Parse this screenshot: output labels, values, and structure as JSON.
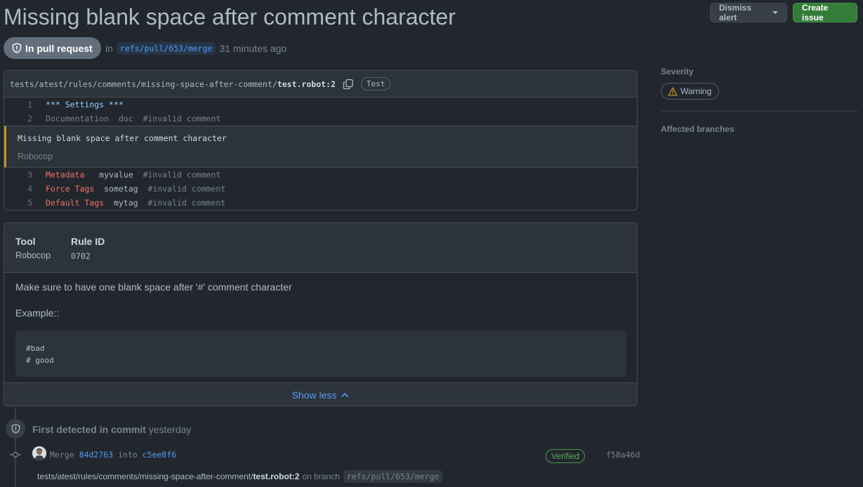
{
  "alert": {
    "title": "Missing blank space after comment character",
    "state": "In pull request",
    "in_word": "in",
    "ref": "refs/pull/653/merge",
    "time": "31 minutes ago"
  },
  "actions": {
    "dismiss_label": "Dismiss alert",
    "create_label": "Create issue"
  },
  "sidebar": {
    "severity_label": "Severity",
    "severity_value": "Warning",
    "branches_label": "Affected branches"
  },
  "code": {
    "path_prefix": "tests/atest/rules/comments/missing-space-after-comment/",
    "path_file": "test.robot:2",
    "tag": "Test",
    "lines_top": [
      {
        "n": "1",
        "a": "*** Settings ***",
        "b": "",
        "c": ""
      },
      {
        "n": "2",
        "a": "Documentation",
        "b": "  doc",
        "c": "  #invalid comment"
      }
    ],
    "alert_message": "Missing blank space after comment character",
    "alert_tool": "Robocop",
    "lines_bottom": [
      {
        "n": "3",
        "a": "Metadata",
        "b": "   myvalue",
        "c": "  #invalid comment"
      },
      {
        "n": "4",
        "a": "Force Tags",
        "b": "  sometag",
        "c": "  #invalid comment"
      },
      {
        "n": "5",
        "a": "Default Tags",
        "b": "  mytag",
        "c": "  #invalid comment"
      }
    ]
  },
  "rule": {
    "tool_label": "Tool",
    "tool_value": "Robocop",
    "id_label": "Rule ID",
    "id_value": "0702",
    "description": "Make sure to have one blank space after '#' comment character",
    "example_label": "Example::",
    "example_line1": "#bad",
    "example_line2": "# good",
    "show_less": "Show less"
  },
  "timeline": {
    "first_detected": "First detected in commit",
    "first_detected_when": "yesterday",
    "commit_merge": "Merge",
    "commit_from": "84d2763",
    "commit_into": "into",
    "commit_to": "c5ee8f6",
    "verified": "Verified",
    "sha": "f58a46d",
    "loc_prefix": "tests/atest/rules/comments/missing-space-after-comment/",
    "loc_file": "test.robot:2",
    "loc_on_branch": "on branch",
    "loc_ref": "refs/pull/653/merge"
  },
  "colors": {
    "background": "#22272e",
    "accent_blue": "#539bf5",
    "warning": "#c69026",
    "success": "#347d39"
  },
  "icons": {
    "state": "shield-icon",
    "warning": "alert-triangle-icon",
    "copy": "copy-icon",
    "show_less": "chevron-up-icon",
    "commit": "git-commit-icon"
  }
}
